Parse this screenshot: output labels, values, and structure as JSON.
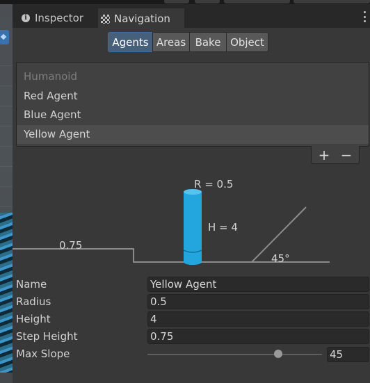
{
  "tabs": {
    "inspector": "Inspector",
    "navigation": "Navigation"
  },
  "segments": [
    "Agents",
    "Areas",
    "Bake",
    "Object"
  ],
  "active_segment": "Agents",
  "agents": {
    "header": "Humanoid",
    "items": [
      "Red Agent",
      "Blue Agent",
      "Yellow Agent"
    ],
    "selected": "Yellow Agent",
    "add_label": "+",
    "remove_label": "−"
  },
  "diagram": {
    "radius_label": "R = 0.5",
    "height_label": "H = 4",
    "step_label": "0.75",
    "slope_label": "45°",
    "agent_color": "#22a6dd"
  },
  "properties": {
    "name": {
      "label": "Name",
      "value": "Yellow Agent"
    },
    "radius": {
      "label": "Radius",
      "value": "0.5"
    },
    "height": {
      "label": "Height",
      "value": "4"
    },
    "step_height": {
      "label": "Step Height",
      "value": "0.75"
    },
    "max_slope": {
      "label": "Max Slope",
      "value": "45",
      "slider_fraction": 0.75
    }
  },
  "colors": {
    "accent": "#46607c",
    "panel": "#383838",
    "field": "#2a2a2a"
  }
}
